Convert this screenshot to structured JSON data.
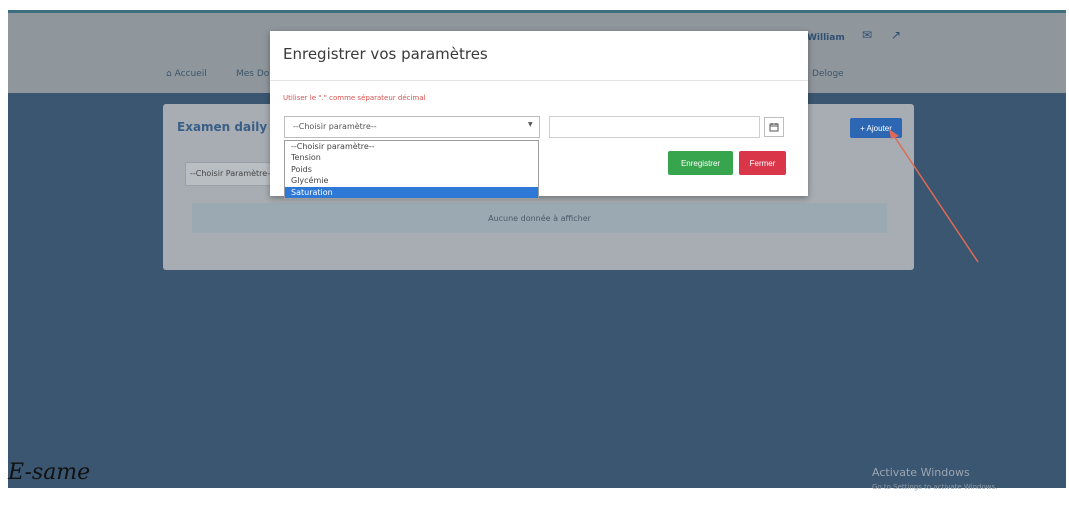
{
  "navbar": {
    "user_name": "William",
    "menu_left": [
      "Accueil",
      "Mes Do"
    ],
    "menu_right": "Deloge",
    "icons": [
      "mail-icon",
      "signout-icon"
    ]
  },
  "card": {
    "title": "Examen daily",
    "add_button": "+ Ajouter",
    "filter_placeholder": "--Choisir Paramètre--",
    "empty_message": "Aucune donnée à afficher"
  },
  "modal": {
    "title": "Enregistrer vos paramètres",
    "hint": "Utiliser le \".\" comme séparateur décimal",
    "select_value": "--Choisir paramètre--",
    "options": [
      "--Choisir paramètre--",
      "Tension",
      "Poids",
      "Glycémie",
      "Saturation"
    ],
    "highlighted_option": "Saturation",
    "value_input": "",
    "save_button": "Enregistrer",
    "close_button": "Fermer"
  },
  "watermark": {
    "signature": "E-same",
    "windows_title": "Activate Windows",
    "windows_sub": "Go to Settings to activate Windows."
  },
  "colors": {
    "navbar": "#8f969c",
    "background": "#3a5670",
    "primary": "#2d67b3",
    "success": "#36a54d",
    "danger": "#d9364a",
    "annotation": "#e06a55"
  }
}
